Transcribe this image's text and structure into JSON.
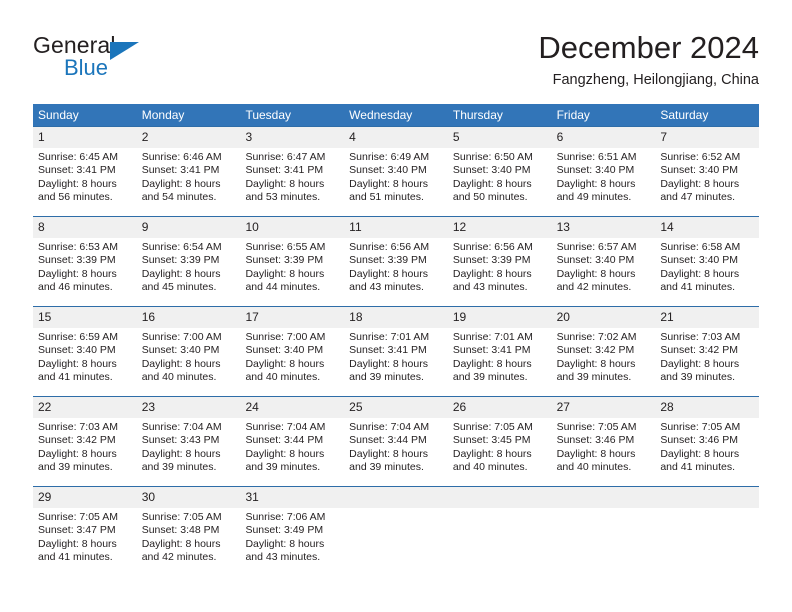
{
  "brand": {
    "name_part1": "General",
    "name_part2": "Blue",
    "flag_icon": "triangle-flag-icon"
  },
  "header": {
    "title": "December 2024",
    "location": "Fangzheng, Heilongjiang, China"
  },
  "calendar": {
    "weekdays": [
      "Sunday",
      "Monday",
      "Tuesday",
      "Wednesday",
      "Thursday",
      "Friday",
      "Saturday"
    ],
    "colors": {
      "header_blue": "#3275b8",
      "row_separator": "#2e6da8",
      "day_band_gray": "#f0f0f0",
      "brand_blue": "#1b75bb",
      "text": "#231f20"
    },
    "weeks": [
      [
        {
          "day": "1",
          "sunrise": "Sunrise: 6:45 AM",
          "sunset": "Sunset: 3:41 PM",
          "daylight1": "Daylight: 8 hours",
          "daylight2": "and 56 minutes."
        },
        {
          "day": "2",
          "sunrise": "Sunrise: 6:46 AM",
          "sunset": "Sunset: 3:41 PM",
          "daylight1": "Daylight: 8 hours",
          "daylight2": "and 54 minutes."
        },
        {
          "day": "3",
          "sunrise": "Sunrise: 6:47 AM",
          "sunset": "Sunset: 3:41 PM",
          "daylight1": "Daylight: 8 hours",
          "daylight2": "and 53 minutes."
        },
        {
          "day": "4",
          "sunrise": "Sunrise: 6:49 AM",
          "sunset": "Sunset: 3:40 PM",
          "daylight1": "Daylight: 8 hours",
          "daylight2": "and 51 minutes."
        },
        {
          "day": "5",
          "sunrise": "Sunrise: 6:50 AM",
          "sunset": "Sunset: 3:40 PM",
          "daylight1": "Daylight: 8 hours",
          "daylight2": "and 50 minutes."
        },
        {
          "day": "6",
          "sunrise": "Sunrise: 6:51 AM",
          "sunset": "Sunset: 3:40 PM",
          "daylight1": "Daylight: 8 hours",
          "daylight2": "and 49 minutes."
        },
        {
          "day": "7",
          "sunrise": "Sunrise: 6:52 AM",
          "sunset": "Sunset: 3:40 PM",
          "daylight1": "Daylight: 8 hours",
          "daylight2": "and 47 minutes."
        }
      ],
      [
        {
          "day": "8",
          "sunrise": "Sunrise: 6:53 AM",
          "sunset": "Sunset: 3:39 PM",
          "daylight1": "Daylight: 8 hours",
          "daylight2": "and 46 minutes."
        },
        {
          "day": "9",
          "sunrise": "Sunrise: 6:54 AM",
          "sunset": "Sunset: 3:39 PM",
          "daylight1": "Daylight: 8 hours",
          "daylight2": "and 45 minutes."
        },
        {
          "day": "10",
          "sunrise": "Sunrise: 6:55 AM",
          "sunset": "Sunset: 3:39 PM",
          "daylight1": "Daylight: 8 hours",
          "daylight2": "and 44 minutes."
        },
        {
          "day": "11",
          "sunrise": "Sunrise: 6:56 AM",
          "sunset": "Sunset: 3:39 PM",
          "daylight1": "Daylight: 8 hours",
          "daylight2": "and 43 minutes."
        },
        {
          "day": "12",
          "sunrise": "Sunrise: 6:56 AM",
          "sunset": "Sunset: 3:39 PM",
          "daylight1": "Daylight: 8 hours",
          "daylight2": "and 43 minutes."
        },
        {
          "day": "13",
          "sunrise": "Sunrise: 6:57 AM",
          "sunset": "Sunset: 3:40 PM",
          "daylight1": "Daylight: 8 hours",
          "daylight2": "and 42 minutes."
        },
        {
          "day": "14",
          "sunrise": "Sunrise: 6:58 AM",
          "sunset": "Sunset: 3:40 PM",
          "daylight1": "Daylight: 8 hours",
          "daylight2": "and 41 minutes."
        }
      ],
      [
        {
          "day": "15",
          "sunrise": "Sunrise: 6:59 AM",
          "sunset": "Sunset: 3:40 PM",
          "daylight1": "Daylight: 8 hours",
          "daylight2": "and 41 minutes."
        },
        {
          "day": "16",
          "sunrise": "Sunrise: 7:00 AM",
          "sunset": "Sunset: 3:40 PM",
          "daylight1": "Daylight: 8 hours",
          "daylight2": "and 40 minutes."
        },
        {
          "day": "17",
          "sunrise": "Sunrise: 7:00 AM",
          "sunset": "Sunset: 3:40 PM",
          "daylight1": "Daylight: 8 hours",
          "daylight2": "and 40 minutes."
        },
        {
          "day": "18",
          "sunrise": "Sunrise: 7:01 AM",
          "sunset": "Sunset: 3:41 PM",
          "daylight1": "Daylight: 8 hours",
          "daylight2": "and 39 minutes."
        },
        {
          "day": "19",
          "sunrise": "Sunrise: 7:01 AM",
          "sunset": "Sunset: 3:41 PM",
          "daylight1": "Daylight: 8 hours",
          "daylight2": "and 39 minutes."
        },
        {
          "day": "20",
          "sunrise": "Sunrise: 7:02 AM",
          "sunset": "Sunset: 3:42 PM",
          "daylight1": "Daylight: 8 hours",
          "daylight2": "and 39 minutes."
        },
        {
          "day": "21",
          "sunrise": "Sunrise: 7:03 AM",
          "sunset": "Sunset: 3:42 PM",
          "daylight1": "Daylight: 8 hours",
          "daylight2": "and 39 minutes."
        }
      ],
      [
        {
          "day": "22",
          "sunrise": "Sunrise: 7:03 AM",
          "sunset": "Sunset: 3:42 PM",
          "daylight1": "Daylight: 8 hours",
          "daylight2": "and 39 minutes."
        },
        {
          "day": "23",
          "sunrise": "Sunrise: 7:04 AM",
          "sunset": "Sunset: 3:43 PM",
          "daylight1": "Daylight: 8 hours",
          "daylight2": "and 39 minutes."
        },
        {
          "day": "24",
          "sunrise": "Sunrise: 7:04 AM",
          "sunset": "Sunset: 3:44 PM",
          "daylight1": "Daylight: 8 hours",
          "daylight2": "and 39 minutes."
        },
        {
          "day": "25",
          "sunrise": "Sunrise: 7:04 AM",
          "sunset": "Sunset: 3:44 PM",
          "daylight1": "Daylight: 8 hours",
          "daylight2": "and 39 minutes."
        },
        {
          "day": "26",
          "sunrise": "Sunrise: 7:05 AM",
          "sunset": "Sunset: 3:45 PM",
          "daylight1": "Daylight: 8 hours",
          "daylight2": "and 40 minutes."
        },
        {
          "day": "27",
          "sunrise": "Sunrise: 7:05 AM",
          "sunset": "Sunset: 3:46 PM",
          "daylight1": "Daylight: 8 hours",
          "daylight2": "and 40 minutes."
        },
        {
          "day": "28",
          "sunrise": "Sunrise: 7:05 AM",
          "sunset": "Sunset: 3:46 PM",
          "daylight1": "Daylight: 8 hours",
          "daylight2": "and 41 minutes."
        }
      ],
      [
        {
          "day": "29",
          "sunrise": "Sunrise: 7:05 AM",
          "sunset": "Sunset: 3:47 PM",
          "daylight1": "Daylight: 8 hours",
          "daylight2": "and 41 minutes."
        },
        {
          "day": "30",
          "sunrise": "Sunrise: 7:05 AM",
          "sunset": "Sunset: 3:48 PM",
          "daylight1": "Daylight: 8 hours",
          "daylight2": "and 42 minutes."
        },
        {
          "day": "31",
          "sunrise": "Sunrise: 7:06 AM",
          "sunset": "Sunset: 3:49 PM",
          "daylight1": "Daylight: 8 hours",
          "daylight2": "and 43 minutes."
        },
        {
          "day": "",
          "sunrise": "",
          "sunset": "",
          "daylight1": "",
          "daylight2": ""
        },
        {
          "day": "",
          "sunrise": "",
          "sunset": "",
          "daylight1": "",
          "daylight2": ""
        },
        {
          "day": "",
          "sunrise": "",
          "sunset": "",
          "daylight1": "",
          "daylight2": ""
        },
        {
          "day": "",
          "sunrise": "",
          "sunset": "",
          "daylight1": "",
          "daylight2": ""
        }
      ]
    ]
  }
}
